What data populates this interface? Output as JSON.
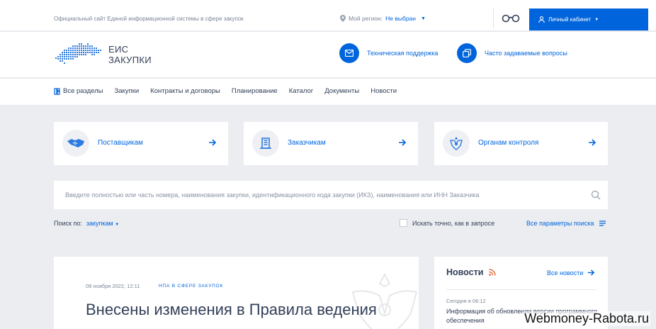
{
  "topbar": {
    "site_title": "Официальный сайт Единой информационной системы в сфере закупок",
    "region_label": "Мой регион:",
    "region_value": "Не выбран",
    "cabinet_label": "Личный кабинет"
  },
  "header": {
    "logo_line1": "ЕИС",
    "logo_line2": "ЗАКУПКИ",
    "support_label": "Техническая поддержка",
    "faq_label": "Часто задаваемые вопросы"
  },
  "nav": {
    "items": [
      "Все разделы",
      "Закупки",
      "Контракты и договоры",
      "Планирование",
      "Каталог",
      "Документы",
      "Новости"
    ]
  },
  "cards": [
    {
      "label": "Поставщикам",
      "icon": "handshake-icon"
    },
    {
      "label": "Заказчикам",
      "icon": "building-icon"
    },
    {
      "label": "Органам контроля",
      "icon": "emblem-icon"
    }
  ],
  "search": {
    "placeholder": "Введите полностью или часть номера, наименования закупки, идентификационного кода закупки (ИКЗ), наименования или ИНН Заказчика",
    "value": "",
    "search_by_label": "Поиск по:",
    "search_by_value": "закупкам",
    "exact_label": "Искать точно, как в запросе",
    "all_params_label": "Все параметры поиска"
  },
  "article": {
    "date": "09 ноября 2022, 12:11",
    "tag": "НПА в сфере закупок",
    "title": "Внесены изменения в Правила ведения"
  },
  "news": {
    "heading": "Новости",
    "all_label": "Все новости",
    "item_time": "Сегодня в 06:12",
    "item_text": "Информация об обновлении версии программного обеспечения"
  },
  "watermark": "Webmoney-Rabota.ru",
  "colors": {
    "accent": "#0065dd",
    "background": "#ebedf0",
    "text": "#334059"
  }
}
